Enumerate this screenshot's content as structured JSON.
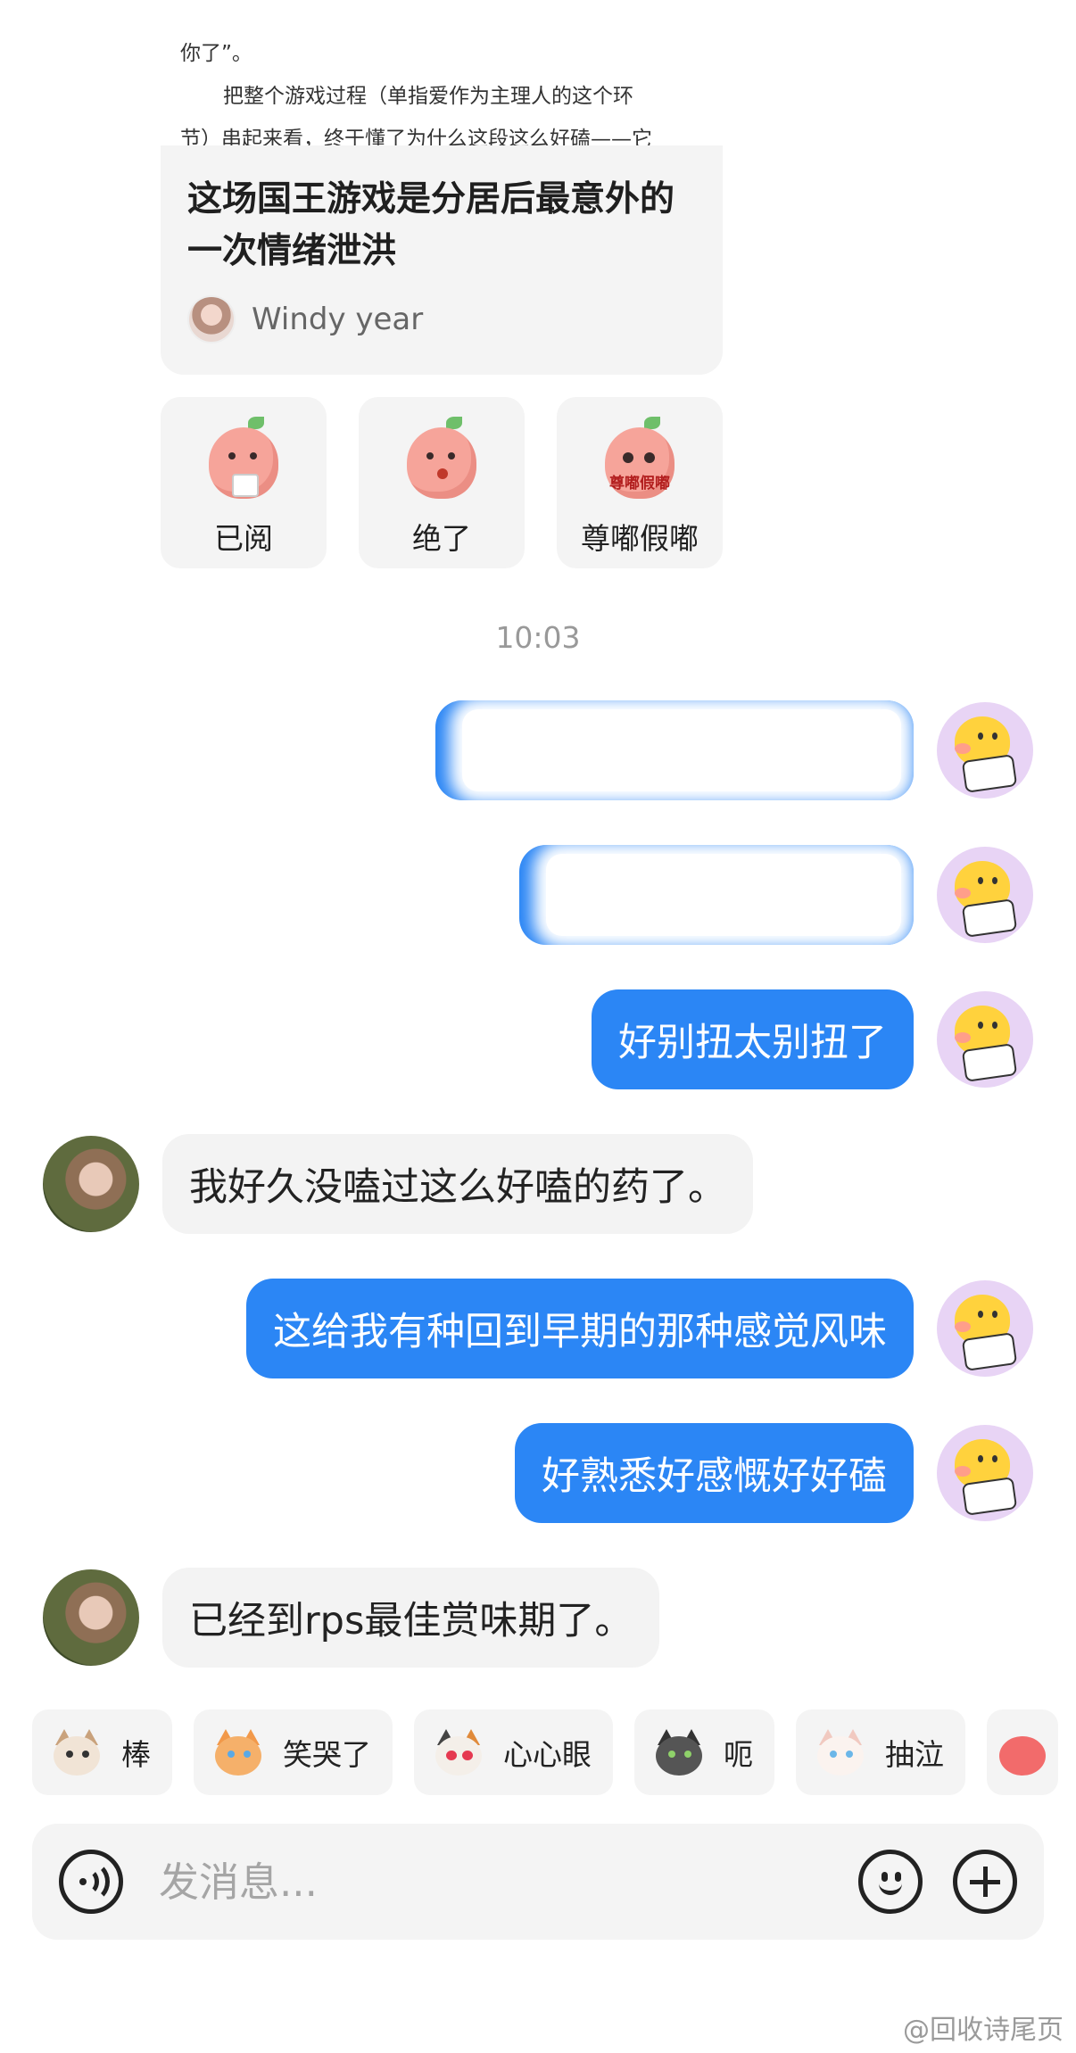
{
  "article_card": {
    "excerpt_lines": [
      "你了”。",
      "把整个游戏过程（单指爱作为主理人的这个环",
      "节）串起来看，终于懂了为什么这段这么好磕——它"
    ],
    "title": "这场国王游戏是分居后最意外的一次情绪泄洪",
    "author": "Windy year"
  },
  "reactions": [
    {
      "label": "已阅",
      "icon": "peach-tea-sticker"
    },
    {
      "label": "绝了",
      "icon": "peach-thumbs-up-sticker"
    },
    {
      "label": "尊嘟假嘟",
      "icon": "peach-surprised-sticker",
      "sticker_text": "尊嘟假嘟"
    }
  ],
  "timestamp": "10:03",
  "messages": [
    {
      "side": "right",
      "text": "",
      "blurred": true
    },
    {
      "side": "right",
      "text": "",
      "blurred": true
    },
    {
      "side": "right",
      "text": "好别扭太别扭了"
    },
    {
      "side": "left",
      "text": "我好久没嗑过这么好嗑的药了。"
    },
    {
      "side": "right",
      "text": "这给我有种回到早期的那种感觉风味"
    },
    {
      "side": "right",
      "text": "好熟悉好感慨好好磕"
    },
    {
      "side": "left",
      "text": "已经到rps最佳赏味期了。"
    }
  ],
  "quick_emojis": [
    {
      "label": "棒",
      "icon": "cat-thumbs-up-icon"
    },
    {
      "label": "笑哭了",
      "icon": "cat-laugh-cry-icon"
    },
    {
      "label": "心心眼",
      "icon": "cat-heart-eyes-icon"
    },
    {
      "label": "呃",
      "icon": "cat-awkward-icon"
    },
    {
      "label": "抽泣",
      "icon": "cat-sob-icon"
    }
  ],
  "input": {
    "placeholder": "发消息...",
    "value": ""
  },
  "watermark": "@回收诗尾页",
  "colors": {
    "outgoing_bubble": "#2b86f5",
    "incoming_bubble": "#f3f3f3",
    "card_background": "#f4f4f4",
    "timestamp": "#999999"
  }
}
